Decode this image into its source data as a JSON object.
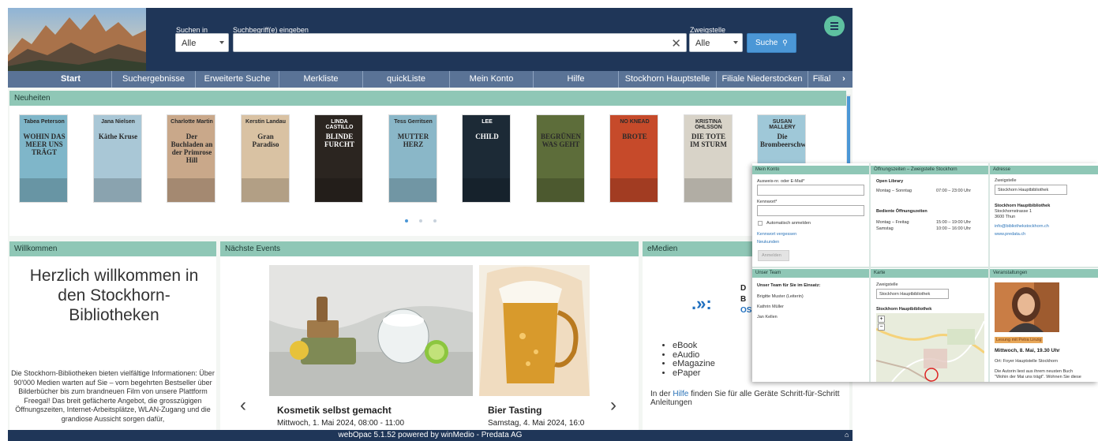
{
  "header": {
    "search_in_label": "Suchen in",
    "search_in_value": "Alle",
    "query_label": "Suchbegriff(e) eingeben",
    "branch_label": "Zweigstelle",
    "branch_value": "Alle",
    "search_button": "Suche"
  },
  "nav": {
    "tabs": [
      "Start",
      "Suchergebnisse",
      "Erweiterte Suche",
      "Merkliste",
      "quickListe",
      "Mein Konto",
      "Hilfe",
      "Stockhorn Hauptstelle",
      "Filiale Niederstocken",
      "Filial"
    ],
    "more": "›"
  },
  "neuheiten": {
    "title": "Neuheiten",
    "books": [
      {
        "author": "Tabea Peterson",
        "title": "WOHIN DAS MEER UNS TRÄGT",
        "color": "#7fb6c9"
      },
      {
        "author": "Jana Nielsen",
        "title": "Käthe Kruse",
        "color": "#a9c7d6"
      },
      {
        "author": "Charlotte Martin",
        "title": "Der Buchladen an der Primrose Hill",
        "color": "#c9a88a"
      },
      {
        "author": "Kerstin Landau",
        "title": "Gran Paradiso",
        "color": "#d9c2a3"
      },
      {
        "author": "LINDA CASTILLO",
        "title": "BLINDE FURCHT",
        "color": "#2b2520"
      },
      {
        "author": "Tess Gerritsen",
        "title": "MUTTER HERZ",
        "color": "#8ab7c8"
      },
      {
        "author": "LEE",
        "title": "CHILD",
        "color": "#1c2a36"
      },
      {
        "author": "",
        "title": "BEGRÜNEN WAS GEHT",
        "color": "#5d6d3a"
      },
      {
        "author": "NO KNEAD",
        "title": "BROTE",
        "color": "#c64a2a"
      },
      {
        "author": "KRISTINA OHLSSON",
        "title": "DIE TOTE IM STURM",
        "color": "#d8d3c8"
      },
      {
        "author": "SUSAN MALLERY",
        "title": "Die Brombeerschwestern",
        "color": "#9fc8d8"
      }
    ]
  },
  "willkommen": {
    "title": "Willkommen",
    "heading": "Herzlich willkommen in den Stockhorn-Bibliotheken",
    "text": "Die Stockhorn-Bibliotheken bieten vielfältige Informationen: Über 90'000 Medien warten auf Sie – vom begehrten Bestseller über Bilderbücher bis zum brandneuen Film von unsere Plattform Freegal! Das breit gefächerte Angebot, die grosszügigen Öffnungszeiten, Internet-Arbeitsplätze, WLAN-Zugang und die grandiose Aussicht sorgen dafür,"
  },
  "events": {
    "title": "Nächste Events",
    "items": [
      {
        "title": "Kosmetik selbst gemacht",
        "date": "Mittwoch, 1. Mai 2024, 08:00 - 11:00"
      },
      {
        "title": "Bier Tasting",
        "date": "Samstag, 4. Mai 2024, 16:0"
      }
    ]
  },
  "emedien": {
    "title": "eMedien",
    "logo_letters": [
      "D",
      "I",
      "B",
      "I",
      "OS"
    ],
    "list": [
      "eBook",
      "eAudio",
      "eMagazine",
      "ePaper"
    ],
    "hint_before": "In der ",
    "hint_link": "Hilfe",
    "hint_after": " finden Sie für alle Geräte Schritt-für-Schritt Anleitungen"
  },
  "footer": {
    "text": "webOpac 5.1.52 powered by winMedio - Predata AG"
  },
  "overlay": {
    "konto": {
      "title": "Mein Konto",
      "user_label": "Ausweis-nr. oder E-Mail*",
      "password_label": "Kennwort*",
      "auto_login": "Automatisch anmelden",
      "forgot": "Kennwort vergessen",
      "register": "Neukunden",
      "login_button": "Anmelden"
    },
    "hours": {
      "title": "Öffnungszeiten – Zweigstelle Stockhorn",
      "open_library": "Open Library",
      "open_days": "Montag – Sonntag",
      "open_time": "07:00 – 23:00 Uhr",
      "staffed": "Bediente Öffnungszeiten",
      "row1_days": "Montag – Freitag",
      "row1_time": "15:00 – 19:00 Uhr",
      "row2_days": "Samstag",
      "row2_time": "10:00 – 16:00 Uhr"
    },
    "adresse": {
      "title": "Adresse",
      "branch_label": "Zweigstelle",
      "branch_value": "Stockhorn Hauptbibliothek",
      "name": "Stockhorn Hauptbibliothek",
      "street": "Stockhornstrasse 1",
      "city": "3600 Thun",
      "email": "info@bibliothekstockhorn.ch",
      "web": "www.predata.ch"
    },
    "team": {
      "title": "Unser Team",
      "intro": "Unser Team für Sie im Einsatz:",
      "members": [
        "Brigitte Muster (Leiterin)",
        "Kathrin Müller",
        "Jan Kellen"
      ]
    },
    "karte": {
      "title": "Karte",
      "branch_label": "Zweigstelle",
      "branch_value": "Stockhorn Hauptbibliothek",
      "map_title": "Stockhorn Hauptbibliothek",
      "zoom_in": "+",
      "zoom_out": "−"
    },
    "veranstaltungen": {
      "title": "Veranstaltungen",
      "event_title": "Lesung mit Petra Linzig",
      "event_date": "Mittwoch, 8. Mai, 19.30 Uhr",
      "event_place": "Ort: Foyer Hauptstelle Stockhorn",
      "event_text1": "Die Autorin liest aus ihrem neusten Buch",
      "event_text2": "\"Wohin der Mai uns trägt\". Wohnen Sie diese"
    }
  },
  "colors": {
    "header_bg": "#1f3658",
    "nav_bg": "#5a7396",
    "panel_head": "#8fc7b6",
    "accent_button": "#4b97d6",
    "menu_button": "#5ec1a0"
  }
}
